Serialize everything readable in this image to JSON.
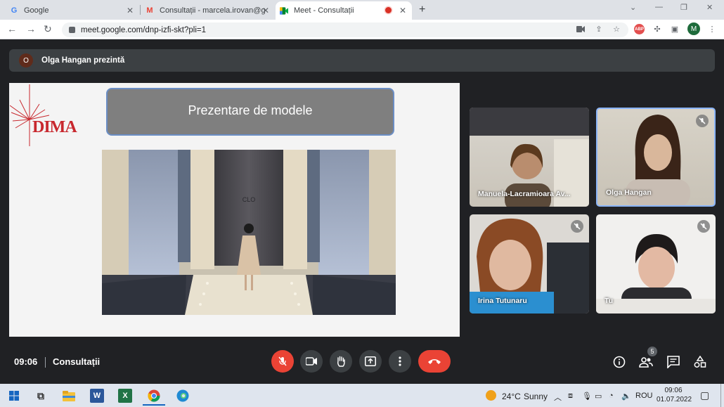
{
  "browser": {
    "tabs": [
      {
        "label": "Google",
        "icon": "google-icon"
      },
      {
        "label": "Consultații - marcela.irovan@gm",
        "icon": "gmail-icon"
      },
      {
        "label": "Meet - Consultații",
        "icon": "meet-icon"
      }
    ],
    "new_tab": "+",
    "url": "meet.google.com/dnp-izfi-skt?pli=1",
    "profile_initial": "M",
    "abp_label": "ABP"
  },
  "meet": {
    "presenter_initial": "O",
    "presenter_text": "Olga Hangan prezintă",
    "slide": {
      "logo_text": "DIMA",
      "title": "Prezentare de modele",
      "stage_logo": "CLO"
    },
    "participants": [
      {
        "name": "Manuela-Lacramioara Av..."
      },
      {
        "name": "Olga Hangan"
      },
      {
        "name": "Irina Tutunaru"
      },
      {
        "name": "Tu"
      }
    ],
    "time": "09:06",
    "meeting_name": "Consultații",
    "people_count": "5"
  },
  "taskbar": {
    "weather_temp": "24°C",
    "weather_text": "Sunny",
    "lang": "ROU",
    "clock_time": "09:06",
    "clock_date": "01.07.2022"
  },
  "colors": {
    "end_call": "#ea4335",
    "mic_off": "#ea4335",
    "accent": "#8ab4f8"
  }
}
